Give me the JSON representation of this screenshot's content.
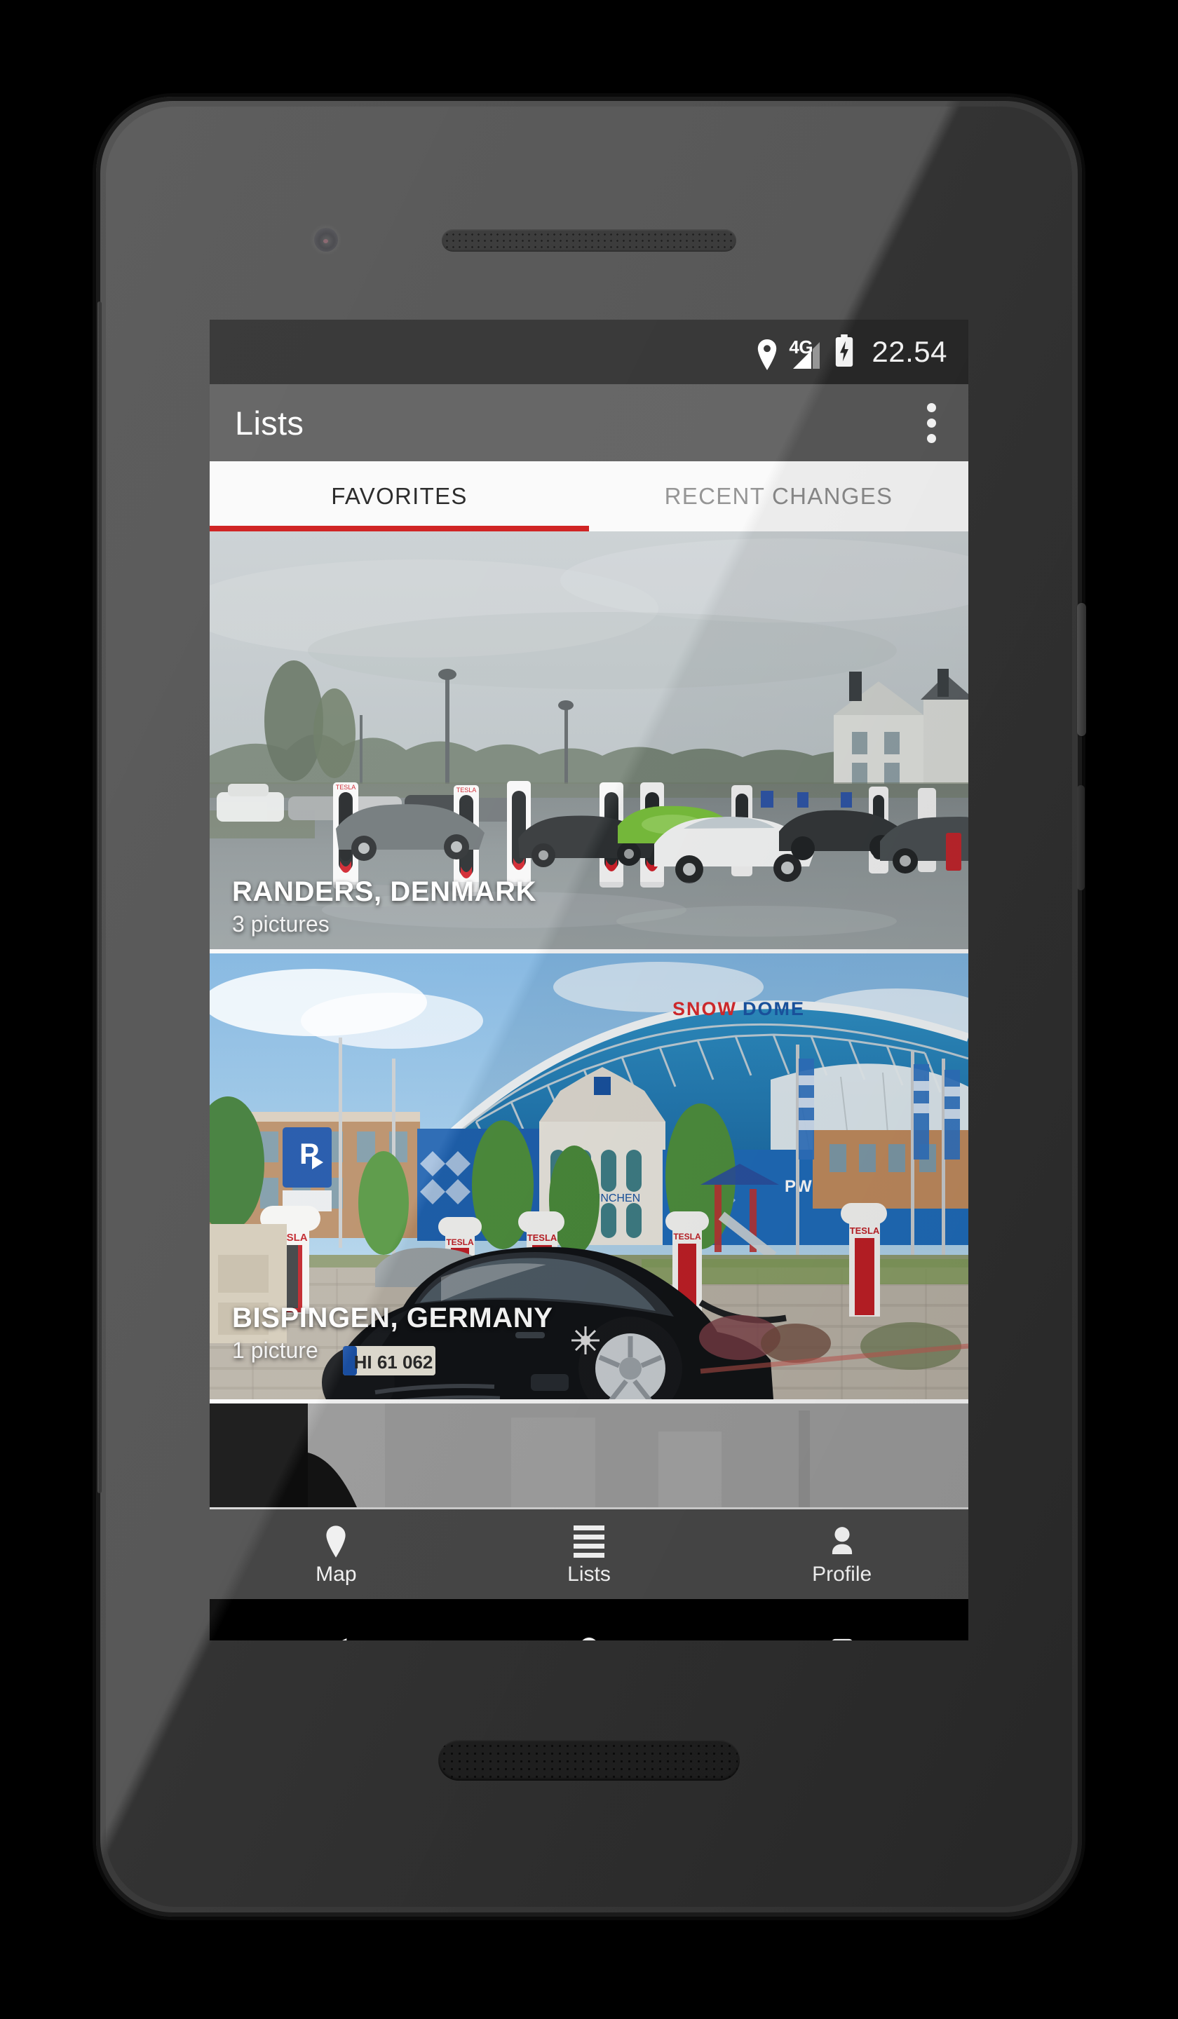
{
  "device": {
    "type": "android-phone",
    "frame_color": "#4a4a4a"
  },
  "statusbar": {
    "location_icon": "location-pin-icon",
    "network_label": "4G",
    "signal_icon": "signal-bars-icon",
    "battery_icon": "battery-charging-icon",
    "time": "22.54"
  },
  "appbar": {
    "title": "Lists",
    "overflow_icon": "overflow-menu-icon",
    "bg": "#5a5a5a"
  },
  "tabs": {
    "indicator_color": "#cc1212",
    "items": [
      {
        "label": "FAVORITES",
        "active": true
      },
      {
        "label": "RECENT CHANGES",
        "active": false
      }
    ]
  },
  "list": {
    "cards": [
      {
        "title": "RANDERS, DENMARK",
        "subtitle": "3 pictures",
        "photo": "tesla-supercharger-rainy-parking-lot"
      },
      {
        "title": "BISPINGEN, GERMANY",
        "subtitle": "1 picture",
        "photo": "tesla-supercharger-snow-dome-black-model-s"
      },
      {
        "title": "",
        "subtitle": "",
        "photo": "partial-card-photo"
      }
    ]
  },
  "bottomnav": {
    "bg": "#4a4a4a",
    "items": [
      {
        "label": "Map",
        "icon": "location-pin-icon",
        "active": false
      },
      {
        "label": "Lists",
        "icon": "list-lines-icon",
        "active": true
      },
      {
        "label": "Profile",
        "icon": "person-icon",
        "active": false
      }
    ]
  },
  "androidnav": {
    "bg": "#000000",
    "items": [
      {
        "name": "back",
        "icon": "back-triangle-icon"
      },
      {
        "name": "home",
        "icon": "home-circle-icon"
      },
      {
        "name": "recents",
        "icon": "recents-square-icon"
      }
    ]
  }
}
